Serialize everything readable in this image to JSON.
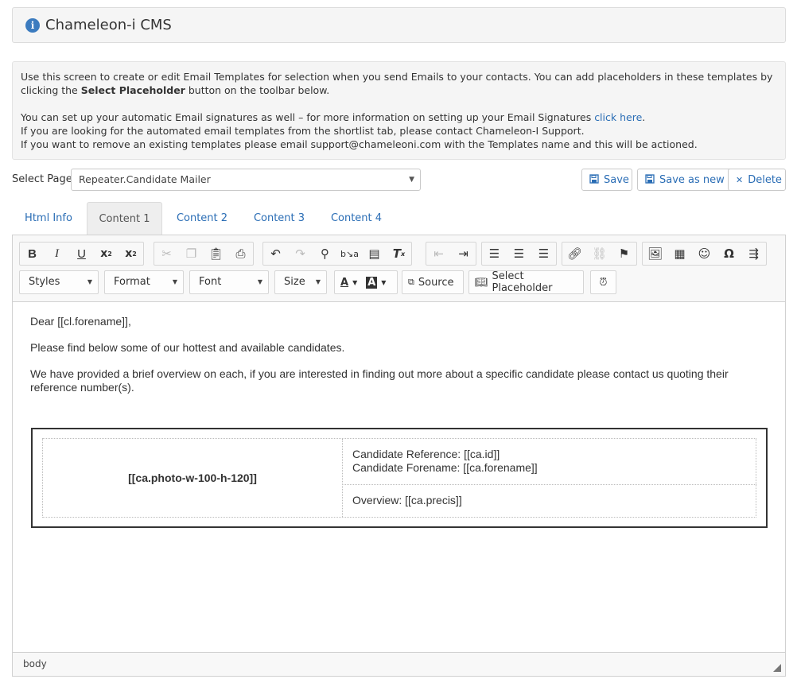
{
  "header": {
    "title": "Chameleon-i CMS"
  },
  "info": {
    "line1": "Use this screen to create or edit Email Templates for selection when you send Emails to your contacts. You can add placeholders in these templates by",
    "line2_pre": "clicking the ",
    "line2_bold": "Select Placeholder",
    "line2_post": " button on the toolbar below.",
    "line3_pre": "You can set up your automatic Email signatures as well – for more information on setting up your Email Signatures ",
    "line3_link": "click here",
    "line3_post": ".",
    "line4": "If you are looking for the automated email templates from the shortlist tab, please contact Chameleon-I Support.",
    "line5": "If you want to remove an existing templates please email support@chameleoni.com with the Templates name and this will be actioned."
  },
  "select_page": {
    "label": "Select Page",
    "value": "Repeater.Candidate Mailer"
  },
  "actions": {
    "save": "Save",
    "save_as_new": "Save as new",
    "delete": "Delete"
  },
  "tabs": [
    "Html Info",
    "Content 1",
    "Content 2",
    "Content 3",
    "Content 4"
  ],
  "toolbar": {
    "styles": "Styles",
    "format": "Format",
    "font": "Font",
    "size": "Size",
    "source": "Source",
    "select_placeholder": "Select Placeholder"
  },
  "body": {
    "greeting": "Dear [[cl.forename]],",
    "para1": "Please find below some of our hottest and available candidates.",
    "para2": "We have provided a brief overview on each, if you are interested in finding out more about a specific candidate please contact us quoting their reference number(s).",
    "photo": "[[ca.photo-w-100-h-120]]",
    "ref": "Candidate Reference: [[ca.id]]",
    "forename": "Candidate Forename: [[ca.forename]]",
    "overview": "Overview: [[ca.precis]]"
  },
  "status": {
    "path": "body"
  }
}
